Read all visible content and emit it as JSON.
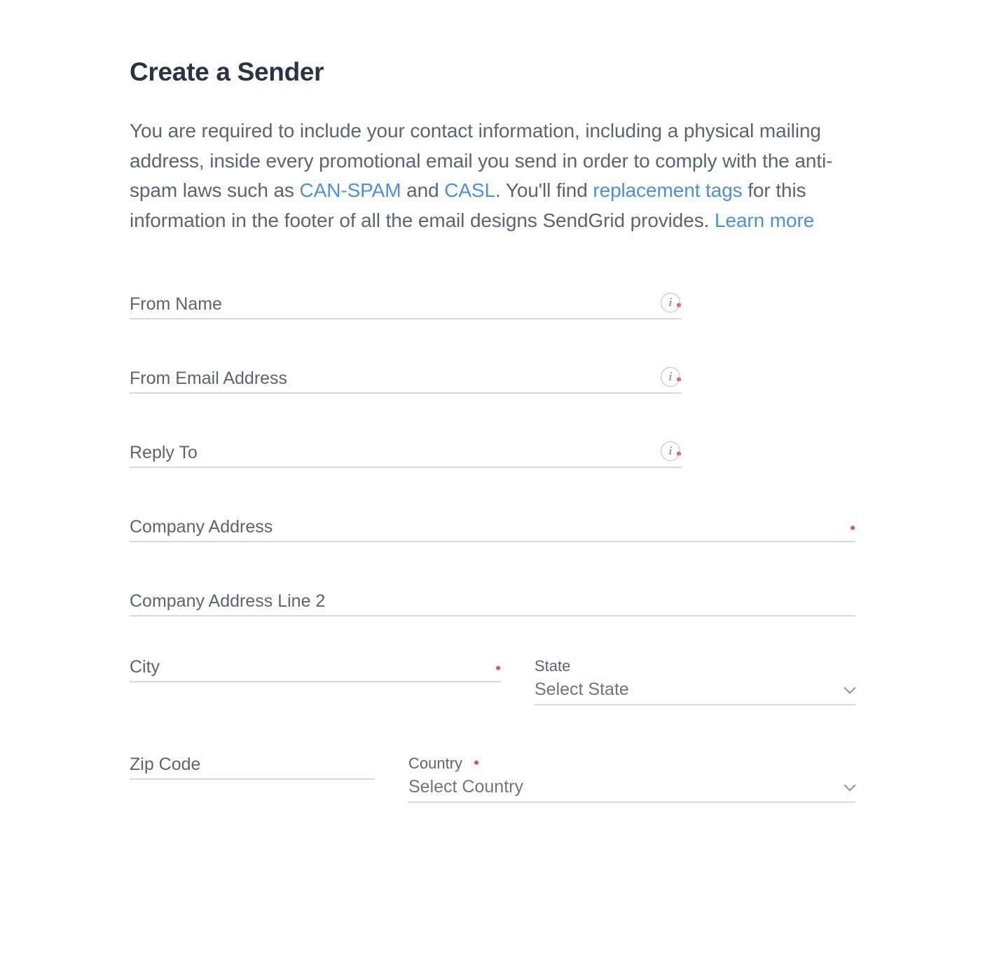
{
  "title": "Create a Sender",
  "description": {
    "text1": "You are required to include your contact information, including a physical mailing address, inside every promotional email you send in order to comply with the anti-spam laws such as ",
    "link_canspam": "CAN-SPAM",
    "text2": " and ",
    "link_casl": "CASL",
    "text3": ". You'll find ",
    "link_tags": "replacement tags",
    "text4": " for this information in the footer of all the email designs SendGrid provides. ",
    "link_learn": "Learn more"
  },
  "fields": {
    "from_name": {
      "label": "From Name",
      "value": ""
    },
    "from_email": {
      "label": "From Email Address",
      "value": ""
    },
    "reply_to": {
      "label": "Reply To",
      "value": ""
    },
    "company_address": {
      "label": "Company Address",
      "value": ""
    },
    "company_address2": {
      "label": "Company Address Line 2",
      "value": ""
    },
    "city": {
      "label": "City",
      "value": ""
    },
    "state": {
      "label": "State",
      "value": "Select State"
    },
    "zip": {
      "label": "Zip Code",
      "value": ""
    },
    "country": {
      "label": "Country",
      "value": "Select Country"
    }
  }
}
